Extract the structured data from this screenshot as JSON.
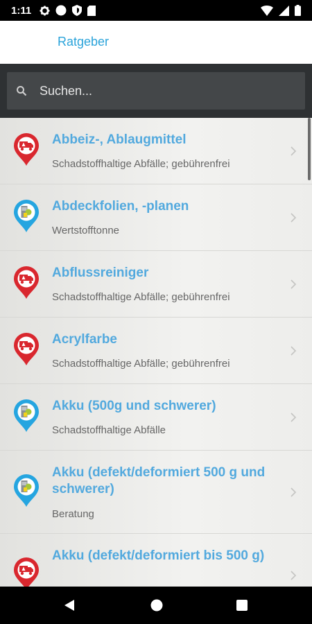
{
  "status_bar": {
    "time": "1:11",
    "left_icons": [
      "settings-gear-icon",
      "circle-icon",
      "shield-icon",
      "sd-card-icon"
    ],
    "right_icons": [
      "wifi-icon",
      "signal-icon",
      "battery-icon"
    ]
  },
  "app_bar": {
    "title": "Ratgeber"
  },
  "search": {
    "placeholder": "Suchen..."
  },
  "colors": {
    "accent": "#2aa3da",
    "item_title": "#52a9de",
    "pin_red": "#d9272e",
    "pin_blue": "#25a5e0"
  },
  "items": [
    {
      "title": "Abbeiz-, Ablaugmittel",
      "subtitle": "Schadstoffhaltige Abfälle; gebührenfrei",
      "icon": "hazardous-truck-pin-icon"
    },
    {
      "title": "Abdeckfolien, -planen",
      "subtitle": "Wertstofftonne",
      "icon": "recycling-bin-pin-icon"
    },
    {
      "title": "Abflussreiniger",
      "subtitle": "Schadstoffhaltige Abfälle; gebührenfrei",
      "icon": "hazardous-truck-pin-icon"
    },
    {
      "title": "Acrylfarbe",
      "subtitle": "Schadstoffhaltige Abfälle; gebührenfrei",
      "icon": "hazardous-truck-pin-icon"
    },
    {
      "title": "Akku (500g und schwerer)",
      "subtitle": "Schadstoffhaltige Abfälle",
      "icon": "recycling-bin-pin-icon"
    },
    {
      "title": "Akku (defekt/deformiert 500 g und schwerer)",
      "subtitle": "Beratung",
      "icon": "recycling-bin-pin-icon"
    },
    {
      "title": "Akku (defekt/deformiert bis 500 g)",
      "subtitle": "",
      "icon": "hazardous-truck-pin-icon"
    }
  ],
  "nav_bar": {
    "buttons": [
      "back-icon",
      "home-icon",
      "recents-icon"
    ]
  }
}
